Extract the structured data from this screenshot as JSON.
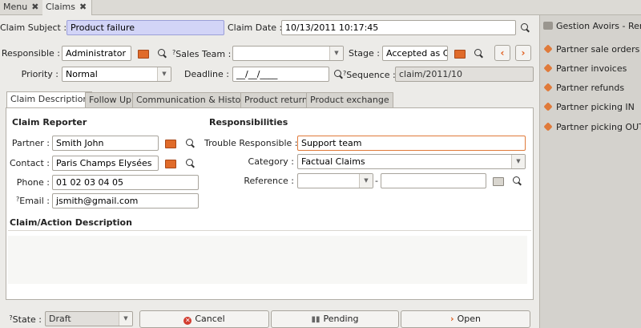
{
  "tabs": [
    {
      "label": "Menu"
    },
    {
      "label": "Claims"
    }
  ],
  "close_glyph": "✖",
  "form": {
    "claim_subject": {
      "label": "Claim Subject :",
      "value": "Product failure"
    },
    "claim_date": {
      "label": "Claim Date :",
      "value": "10/13/2011 10:17:45"
    },
    "responsible": {
      "label": "Responsible :",
      "value": "Administrator"
    },
    "sales_team": {
      "label": "Sales Team :",
      "help": "?",
      "value": ""
    },
    "stage": {
      "label": "Stage :",
      "value": "Accepted as Cla"
    },
    "priority": {
      "label": "Priority :",
      "value": "Normal"
    },
    "deadline": {
      "label": "Deadline :",
      "value": "__/__/____"
    },
    "sequence": {
      "label": "Sequence :",
      "help": "?",
      "value": "claim/2011/10"
    }
  },
  "notebook_tabs": [
    "Claim Description",
    "Follow Up",
    "Communication & History",
    "Product return",
    "Product exchange"
  ],
  "claim_reporter": {
    "title": "Claim Reporter",
    "partner": {
      "label": "Partner :",
      "value": "Smith John"
    },
    "contact": {
      "label": "Contact :",
      "value": "Paris Champs Elysées"
    },
    "phone": {
      "label": "Phone :",
      "value": "01 02 03 04 05"
    },
    "email": {
      "label": "Email :",
      "help": "?",
      "value": "jsmith@gmail.com"
    }
  },
  "responsibilities": {
    "title": "Responsibilities",
    "trouble_responsible": {
      "label": "Trouble Responsible :",
      "value": "Support team"
    },
    "category": {
      "label": "Category :",
      "value": "Factual Claims"
    },
    "reference": {
      "label": "Reference :",
      "value": "",
      "separator": "-"
    }
  },
  "description": {
    "title": "Claim/Action Description",
    "value": ""
  },
  "footer": {
    "state": {
      "label": "State :",
      "help": "?",
      "value": "Draft"
    },
    "cancel": "Cancel",
    "pending": "Pending",
    "open": "Open"
  },
  "sidebar": {
    "title": "Gestion Avoirs - Remb",
    "links": [
      "Partner sale orders",
      "Partner invoices",
      "Partner refunds",
      "Partner picking IN",
      "Partner picking OUT"
    ]
  },
  "colors": {
    "required": "#d2d4f7",
    "accent": "#e07a3a"
  }
}
